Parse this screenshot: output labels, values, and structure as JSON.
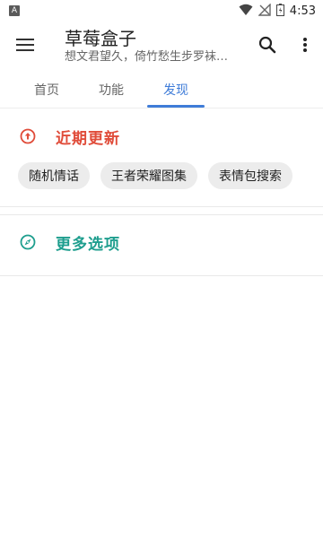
{
  "status_bar": {
    "notification_icon_letter": "A",
    "time": "4:53",
    "icons": [
      "wifi-icon",
      "no-signal-icon",
      "battery-icon"
    ]
  },
  "app_bar": {
    "title": "草莓盒子",
    "subtitle": "想文君望久，倚竹愁生步罗袜…",
    "menu_icon": "hamburger-menu-icon",
    "search_icon": "search-icon",
    "overflow_icon": "more-vert-icon"
  },
  "tabs": [
    {
      "label": "首页",
      "active": false
    },
    {
      "label": "功能",
      "active": false
    },
    {
      "label": "发现",
      "active": true
    }
  ],
  "recent_section": {
    "title": "近期更新",
    "icon": "arrow-up-circle-icon",
    "color": "#e04c3a",
    "chips": [
      "随机情话",
      "王者荣耀图集",
      "表情包搜索"
    ]
  },
  "more_section": {
    "title": "更多选项",
    "icon": "compass-icon",
    "color": "#1e9e8e"
  },
  "accent_color": "#3f7cd8"
}
